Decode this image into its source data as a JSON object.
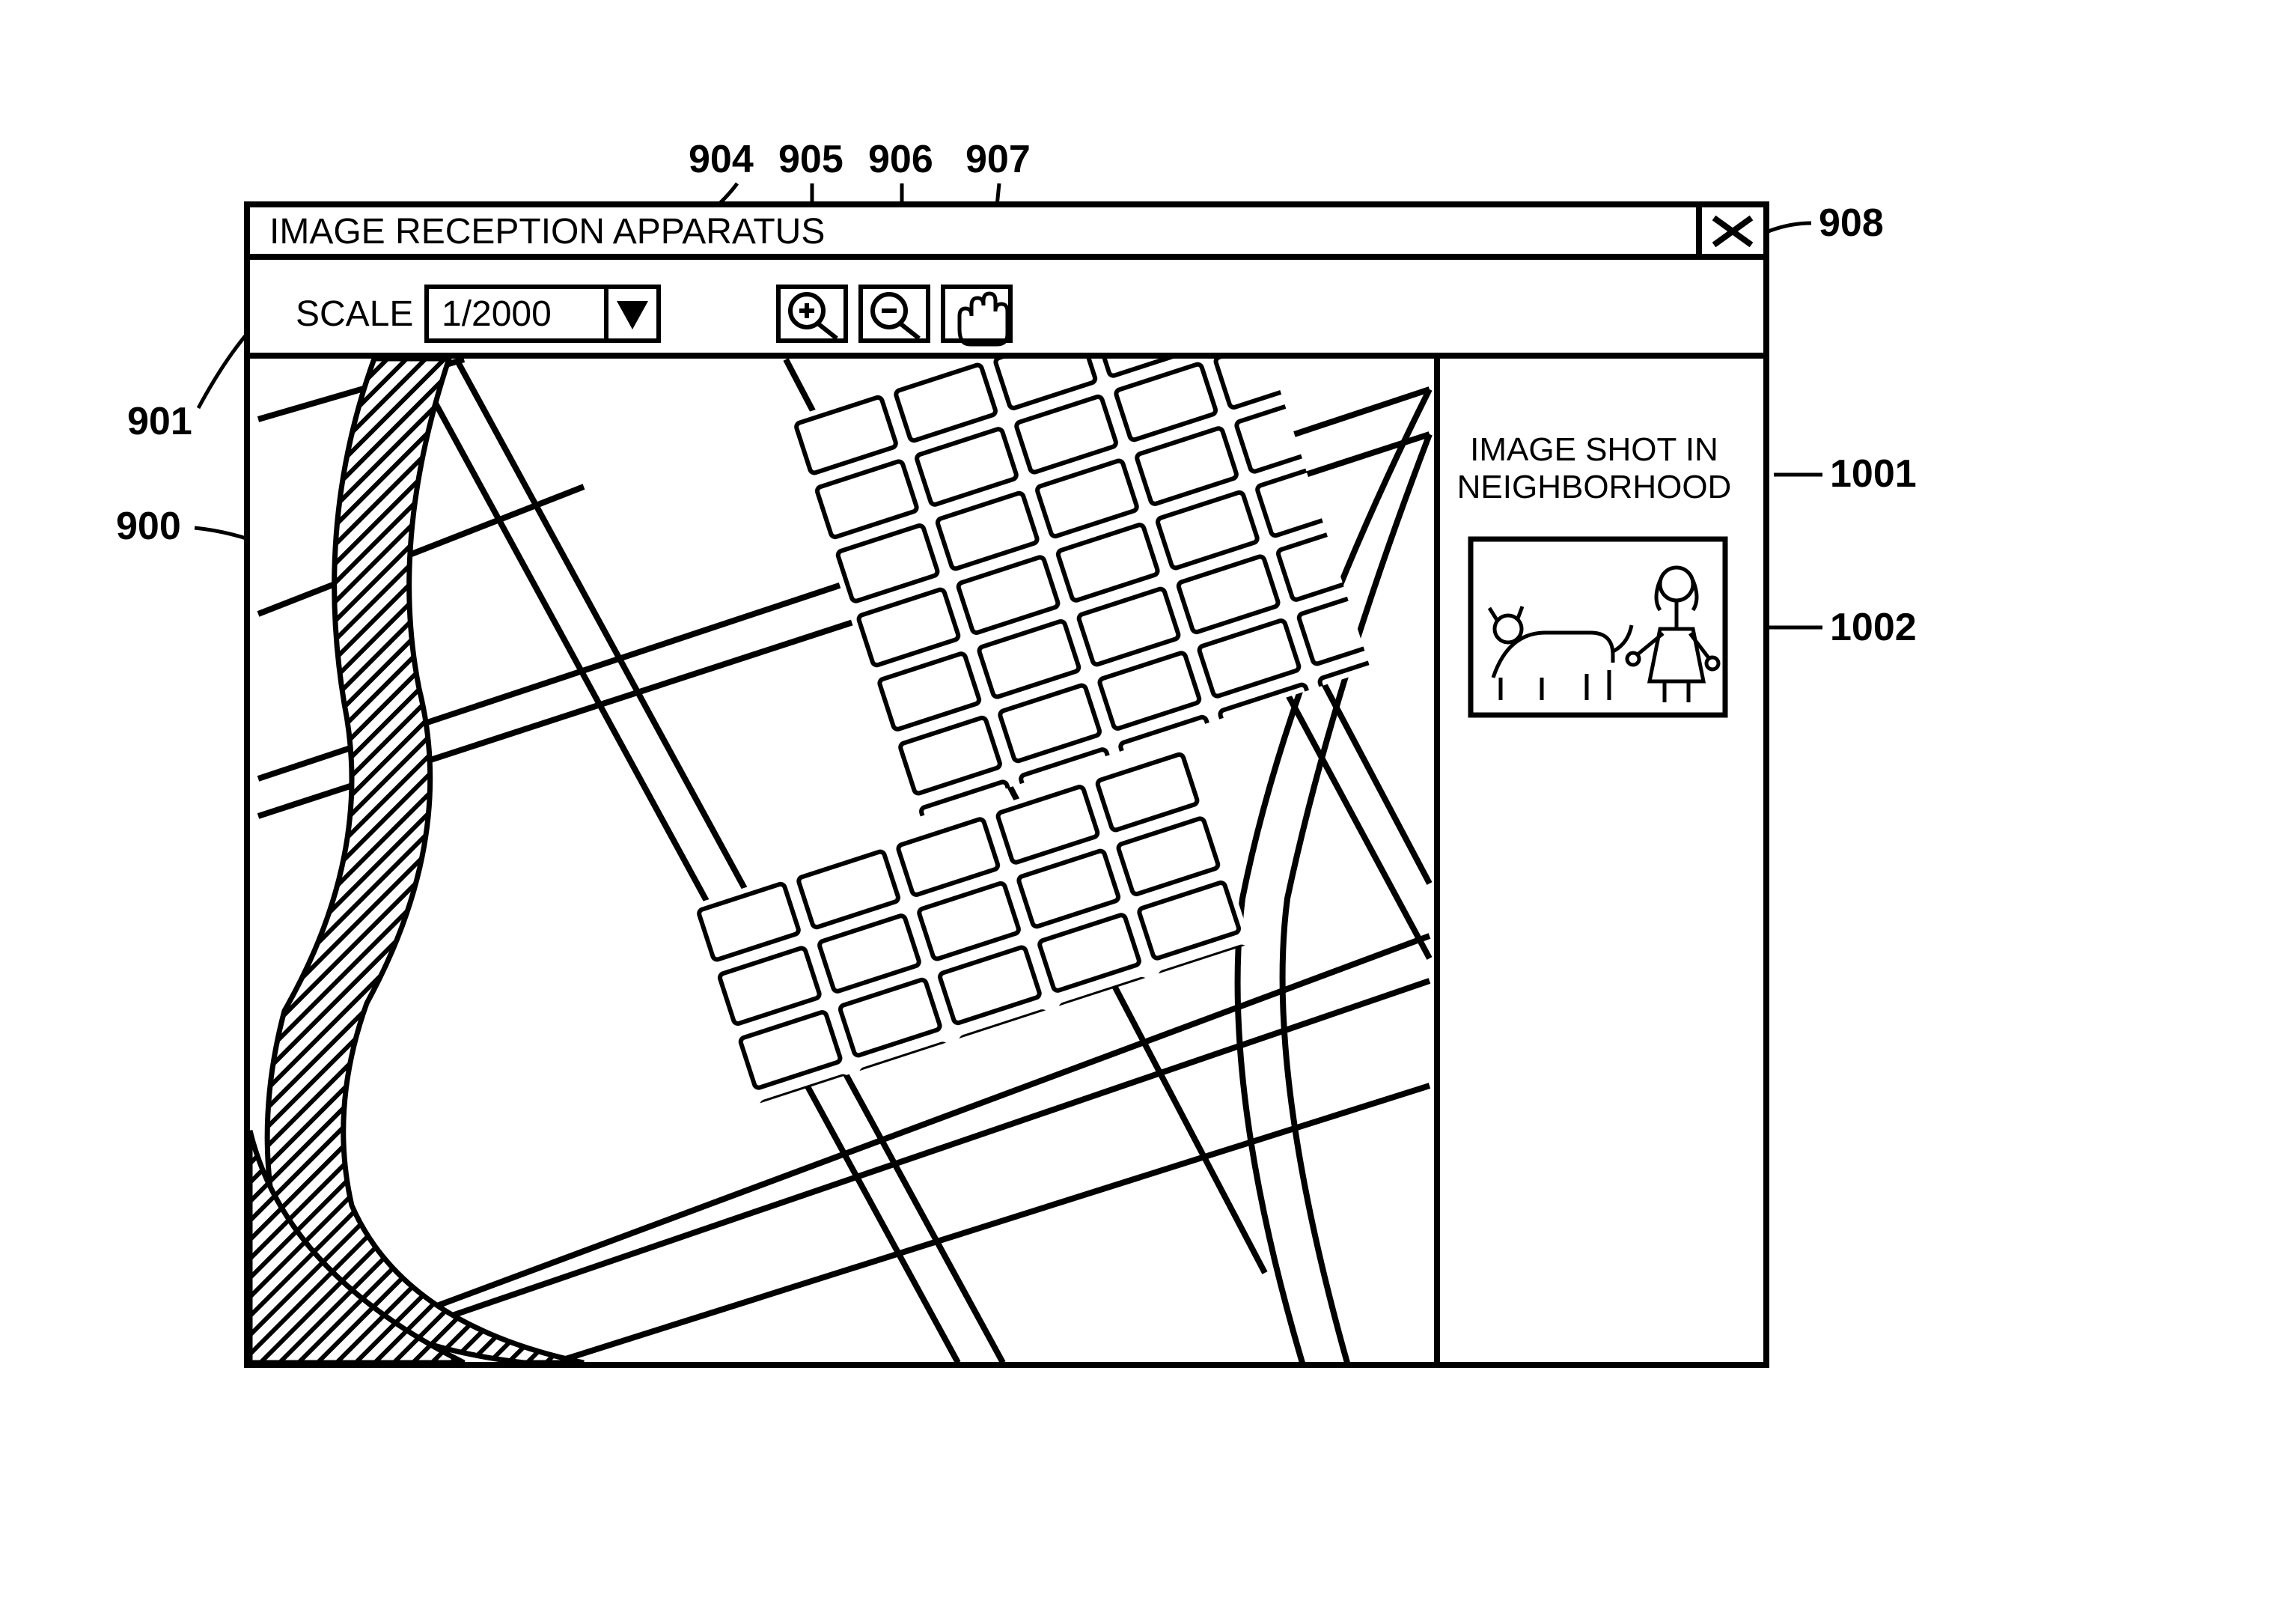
{
  "window": {
    "title": "IMAGE RECEPTION APPARATUS"
  },
  "toolbar": {
    "scale_label": "SCALE",
    "scale_value": "1/2000"
  },
  "side_panel": {
    "title_line1": "IMAGE SHOT IN",
    "title_line2": "NEIGHBORHOOD"
  },
  "callouts": {
    "c904": "904",
    "c905": "905",
    "c906": "906",
    "c907": "907",
    "c908": "908",
    "c901": "901",
    "c900": "900",
    "c1001": "1001",
    "c1002": "1002"
  }
}
